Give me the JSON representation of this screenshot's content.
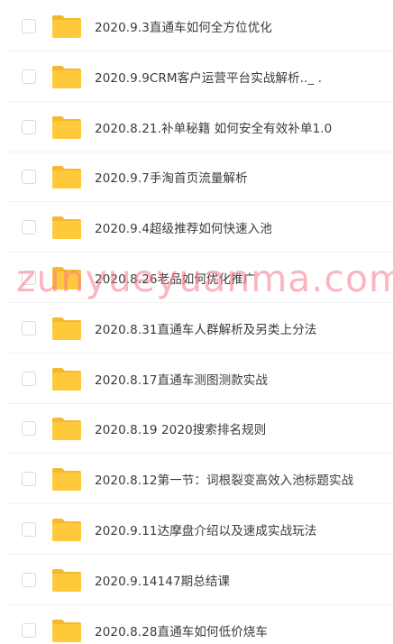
{
  "files": [
    {
      "name": "2020.9.3直通车如何全方位优化"
    },
    {
      "name": "2020.9.9CRM客户运营平台实战解析.._  ."
    },
    {
      "name": "2020.8.21.补单秘籍 如何安全有效补单1.0"
    },
    {
      "name": "2020.9.7手淘首页流量解析"
    },
    {
      "name": "2020.9.4超级推荐如何快速入池"
    },
    {
      "name": "2020.8.26老品如何优化推广"
    },
    {
      "name": "2020.8.31直通车人群解析及另类上分法"
    },
    {
      "name": "2020.8.17直通车测图测款实战"
    },
    {
      "name": "2020.8.19 2020搜索排名规则"
    },
    {
      "name": "2020.8.12第一节：词根裂变高效入池标题实战"
    },
    {
      "name": "2020.9.11达摩盘介绍以及速成实战玩法"
    },
    {
      "name": "2020.9.14147期总结课"
    },
    {
      "name": "2020.8.28直通车如何低价烧车"
    }
  ],
  "watermark": "zunyueyuanma.com",
  "colors": {
    "folder": "#ffc93c",
    "folder_tab": "#f5b82e",
    "watermark": "#f5788c"
  }
}
